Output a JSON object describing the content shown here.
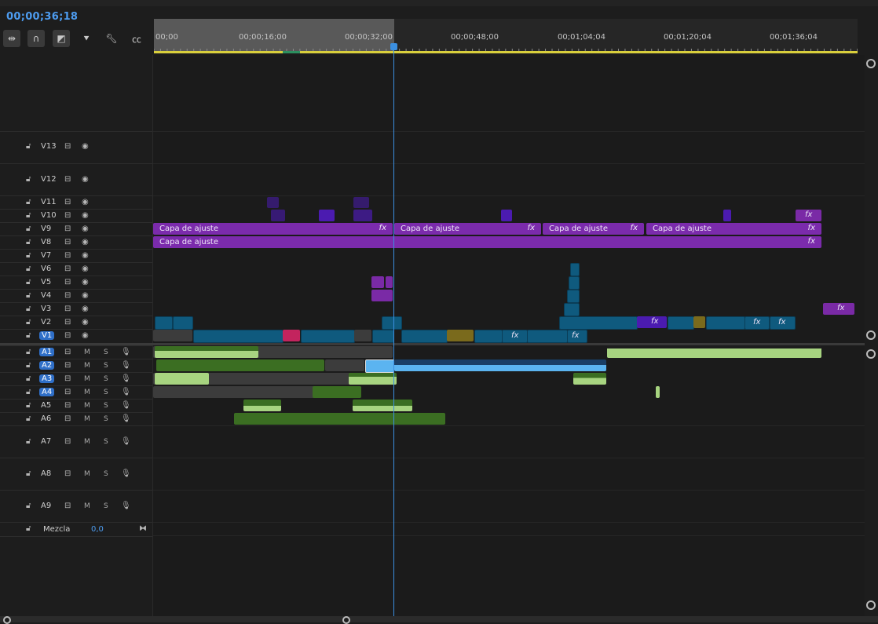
{
  "timecode": "00;00;36;18",
  "ruler_labels": [
    "00;00",
    "00;00;16;00",
    "00;00;32;00",
    "00;00;48;00",
    "00;01;04;04",
    "00;01;20;04",
    "00;01;36;04"
  ],
  "tools": [
    "insert-snap-icon",
    "magnet-icon",
    "linked-selection-icon",
    "marker-icon",
    "wrench-icon",
    "captions-icon"
  ],
  "video_tracks": [
    "V13",
    "V12",
    "V11",
    "V10",
    "V9",
    "V8",
    "V7",
    "V6",
    "V5",
    "V4",
    "V3",
    "V2",
    "V1"
  ],
  "audio_tracks": [
    "A1",
    "A2",
    "A3",
    "A4",
    "A5",
    "A6",
    "A7",
    "A8",
    "A9"
  ],
  "mute_label": "M",
  "solo_label": "S",
  "mix": {
    "label": "Mezcla",
    "value": "0,0"
  },
  "adjustment_label": "Capa de ajuste",
  "fx_label": "fx",
  "colors": {
    "accent": "#4d9cf0",
    "adjustment": "#7b2bac",
    "video_clip": "#0f5a7e",
    "audio_clip": "#3b6e22",
    "audio_selected": "#5bb4f0"
  }
}
